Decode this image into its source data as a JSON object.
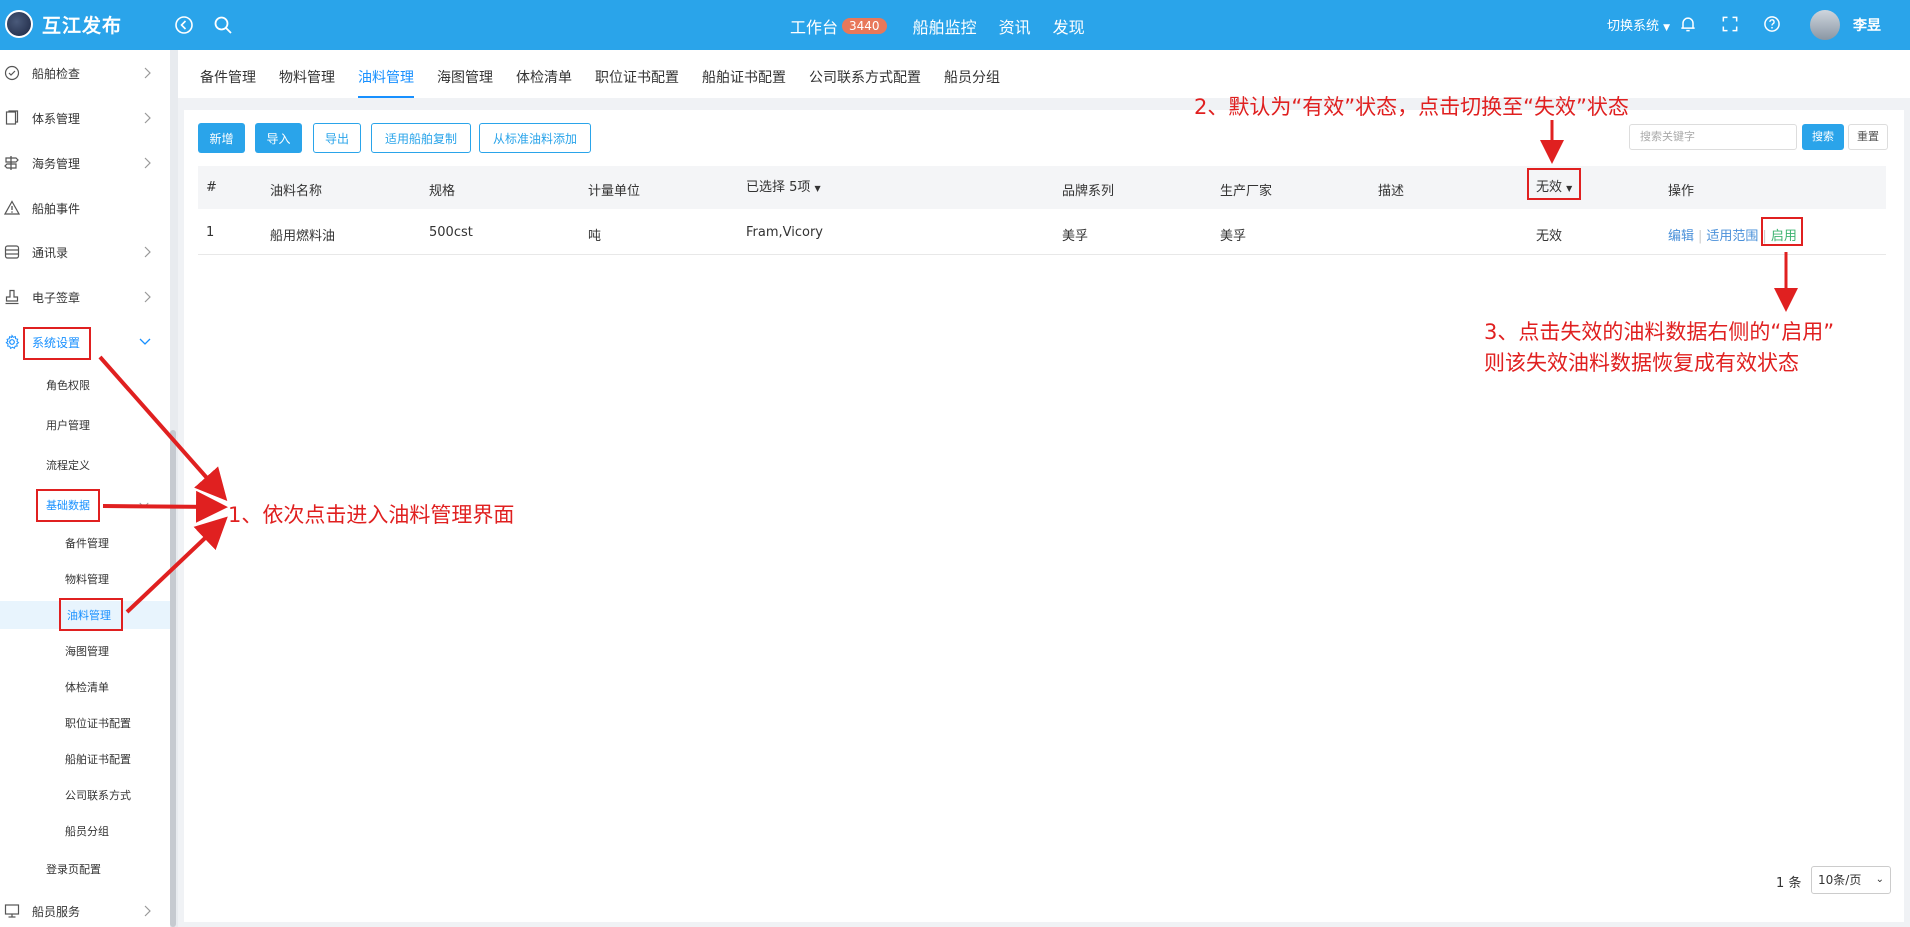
{
  "app": {
    "title": "互江发布"
  },
  "topnav": {
    "workbench": "工作台",
    "workbench_badge": "3440",
    "items": [
      "船舶监控",
      "资讯",
      "发现"
    ],
    "switch_system": "切换系统",
    "user_name": "李昱"
  },
  "sidebar": {
    "items": [
      {
        "label": "船舶检查",
        "icon": "check-circle-icon"
      },
      {
        "label": "体系管理",
        "icon": "document-icon"
      },
      {
        "label": "海务管理",
        "icon": "signpost-icon"
      },
      {
        "label": "船舶事件",
        "icon": "warning-icon"
      },
      {
        "label": "通讯录",
        "icon": "contacts-icon"
      },
      {
        "label": "电子签章",
        "icon": "stamp-icon"
      },
      {
        "label": "系统设置",
        "icon": "gear-icon"
      }
    ],
    "system_sub": [
      "角色权限",
      "用户管理",
      "流程定义",
      "基础数据"
    ],
    "basic_data_sub": [
      "备件管理",
      "物料管理",
      "油料管理",
      "海图管理",
      "体检清单",
      "职位证书配置",
      "船舶证书配置",
      "公司联系方式",
      "船员分组"
    ],
    "login_page": "登录页配置",
    "crew_service": {
      "label": "船员服务",
      "icon": "monitor-icon"
    }
  },
  "tabs": [
    "备件管理",
    "物料管理",
    "油料管理",
    "海图管理",
    "体检清单",
    "职位证书配置",
    "船舶证书配置",
    "公司联系方式配置",
    "船员分组"
  ],
  "toolbar": {
    "add": "新增",
    "import": "导入",
    "export": "导出",
    "copy_ship": "适用船舶复制",
    "add_from_standard": "从标准油料添加"
  },
  "search": {
    "placeholder": "搜索关键字",
    "search_label": "搜索",
    "reset_label": "重置"
  },
  "table": {
    "headers": {
      "index": "#",
      "name": "油料名称",
      "spec": "规格",
      "unit": "计量单位",
      "selected": "已选择 5项",
      "brand": "品牌系列",
      "maker": "生产厂家",
      "desc": "描述",
      "status": "无效",
      "ops": "操作"
    },
    "rows": [
      {
        "index": "1",
        "name": "船用燃料油",
        "spec": "500cst",
        "unit": "吨",
        "selected": "Fram,Vicory",
        "brand": "美孚",
        "maker": "美孚",
        "desc": "",
        "status": "无效",
        "ops": {
          "edit": "编辑",
          "scope": "适用范围",
          "enable": "启用"
        }
      }
    ]
  },
  "pager": {
    "count": "1 条",
    "page_size": "10条/页"
  },
  "annotations": {
    "step1": "1、依次点击进入油料管理界面",
    "step2": "2、默认为“有效”状态，点击切换至“失效”状态",
    "step3_line1": "3、点击失效的油料数据右侧的“启用”",
    "step3_line2": "则该失效油料数据恢复成有效状态"
  },
  "colors": {
    "brand": "#2aa4ea",
    "annotation": "#e02020",
    "enable_link": "#3cb371"
  }
}
